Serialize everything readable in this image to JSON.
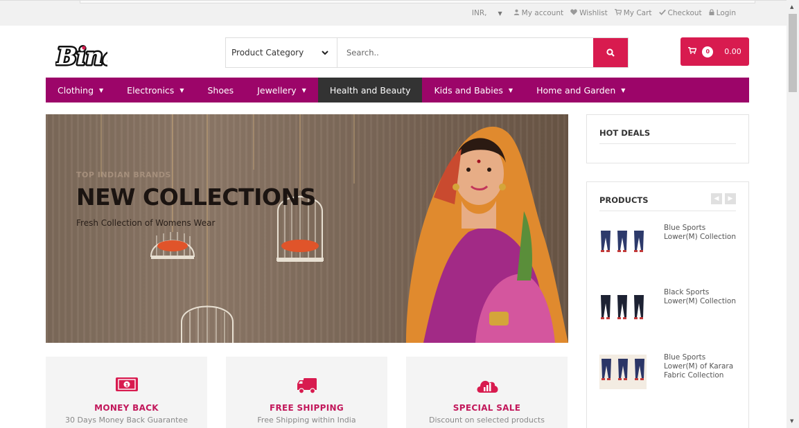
{
  "topbar": {
    "currency": "INR,",
    "links": [
      {
        "icon": "user-icon",
        "label": "My account"
      },
      {
        "icon": "heart-icon",
        "label": "Wishlist"
      },
      {
        "icon": "cart-icon",
        "label": "My Cart"
      },
      {
        "icon": "check-icon",
        "label": "Checkout"
      },
      {
        "icon": "lock-icon",
        "label": "Login"
      }
    ]
  },
  "brand": {
    "logo_text": "Bina"
  },
  "search": {
    "category_label": "Product Category",
    "placeholder": "Search.."
  },
  "cart": {
    "count": "0",
    "total": "0.00"
  },
  "nav": {
    "items": [
      {
        "label": "Clothing",
        "dropdown": true
      },
      {
        "label": "Electronics",
        "dropdown": true
      },
      {
        "label": "Shoes",
        "dropdown": false
      },
      {
        "label": "Jewellery",
        "dropdown": true
      },
      {
        "label": "Health and Beauty",
        "dropdown": false,
        "active": true
      },
      {
        "label": "Kids and Babies",
        "dropdown": true
      },
      {
        "label": "Home and Garden",
        "dropdown": true
      }
    ]
  },
  "banner": {
    "subtitle": "TOP INDIAN BRANDS",
    "title": "NEW COLLECTIONS",
    "text": "Fresh Collection of Womens Wear"
  },
  "features": [
    {
      "icon": "money-icon",
      "title": "MONEY BACK",
      "subtitle": "30 Days Money Back Guarantee"
    },
    {
      "icon": "truck-icon",
      "title": "FREE SHIPPING",
      "subtitle": "Free Shipping within India"
    },
    {
      "icon": "sale-icon",
      "title": "SPECIAL SALE",
      "subtitle": "Discount on selected products"
    }
  ],
  "hot_deals": {
    "title": "HOT DEALS"
  },
  "products": {
    "title": "PRODUCTS",
    "items": [
      {
        "name": "Blue Sports Lower(M) Collection"
      },
      {
        "name": "Black Sports Lower(M) Collection"
      },
      {
        "name": "Blue Sports Lower(M) of Karara Fabric Collection"
      }
    ]
  },
  "colors": {
    "accent": "#d81b4f",
    "nav": "#9c0569",
    "nav_active": "#333333"
  }
}
